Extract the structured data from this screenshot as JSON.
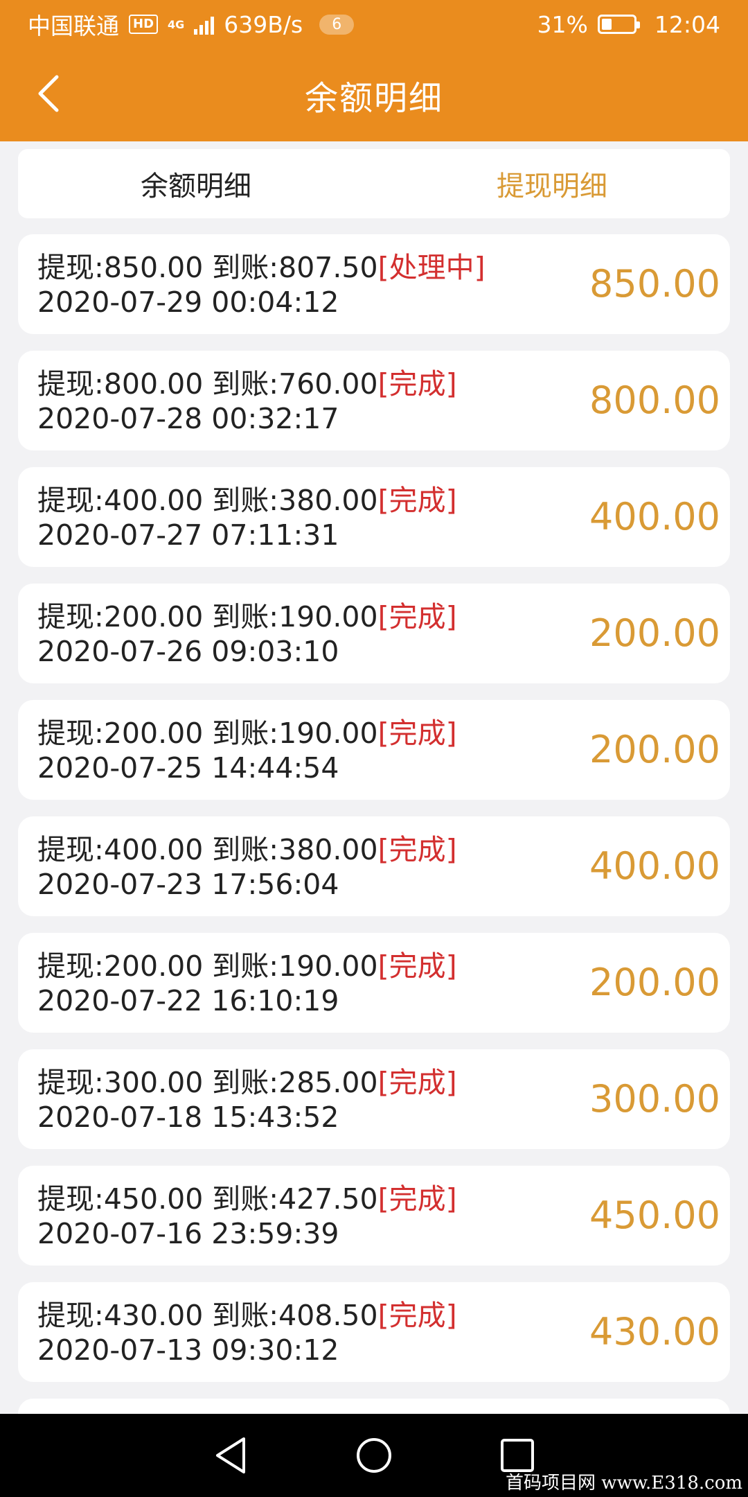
{
  "status_bar": {
    "carrier": "中国联通",
    "hd": "HD",
    "network": "4G",
    "speed": "639B/s",
    "notif_count": "6",
    "battery": "31%",
    "time": "12:04"
  },
  "header": {
    "title": "余额明细"
  },
  "tabs": [
    {
      "label": "余额明细",
      "active": false
    },
    {
      "label": "提现明细",
      "active": true
    }
  ],
  "records": [
    {
      "summary": "提现:850.00 到账:807.50",
      "status": "[处理中]",
      "time": "2020-07-29 00:04:12",
      "amount": "850.00"
    },
    {
      "summary": "提现:800.00 到账:760.00",
      "status": "[完成]",
      "time": "2020-07-28 00:32:17",
      "amount": "800.00"
    },
    {
      "summary": "提现:400.00 到账:380.00",
      "status": "[完成]",
      "time": "2020-07-27 07:11:31",
      "amount": "400.00"
    },
    {
      "summary": "提现:200.00 到账:190.00",
      "status": "[完成]",
      "time": "2020-07-26 09:03:10",
      "amount": "200.00"
    },
    {
      "summary": "提现:200.00 到账:190.00",
      "status": "[完成]",
      "time": "2020-07-25 14:44:54",
      "amount": "200.00"
    },
    {
      "summary": "提现:400.00 到账:380.00",
      "status": "[完成]",
      "time": "2020-07-23 17:56:04",
      "amount": "400.00"
    },
    {
      "summary": "提现:200.00 到账:190.00",
      "status": "[完成]",
      "time": "2020-07-22 16:10:19",
      "amount": "200.00"
    },
    {
      "summary": "提现:300.00 到账:285.00",
      "status": "[完成]",
      "time": "2020-07-18 15:43:52",
      "amount": "300.00"
    },
    {
      "summary": "提现:450.00 到账:427.50",
      "status": "[完成]",
      "time": "2020-07-16 23:59:39",
      "amount": "450.00"
    },
    {
      "summary": "提现:430.00 到账:408.50",
      "status": "[完成]",
      "time": "2020-07-13 09:30:12",
      "amount": "430.00"
    }
  ],
  "watermark": "首码项目网 www.E318.com",
  "colors": {
    "brand": "#ea8c1e",
    "amount": "#d99a35",
    "status": "#d32f2f"
  }
}
